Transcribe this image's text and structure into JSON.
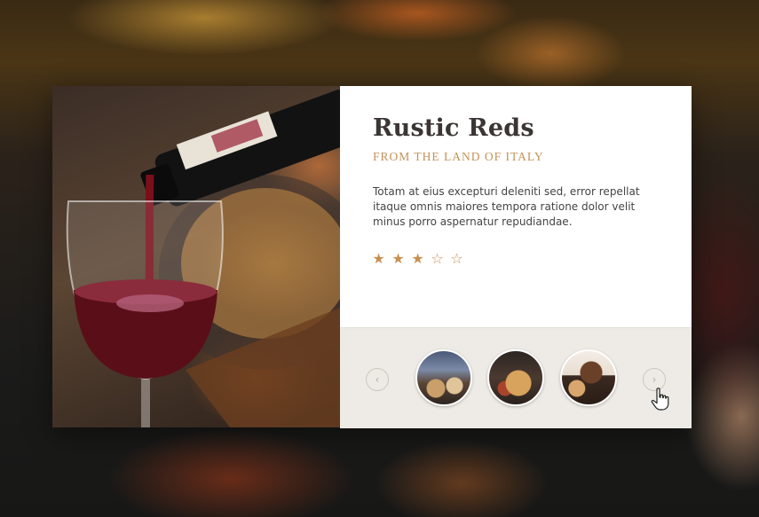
{
  "card": {
    "title": "Rustic Reds",
    "subtitle": "FROM THE LAND OF ITALY",
    "description": "Totam at eius excepturi deleniti sed, error repellat itaque omnis maiores tempora ratione dolor velit minus porro aspernatur repudiandae.",
    "image_icon": "wine-pour-photo"
  },
  "rating": {
    "value": 3,
    "max": 5,
    "filled_glyph": "★",
    "empty_glyph": "☆"
  },
  "carousel": {
    "prev_glyph": "‹",
    "next_glyph": "›",
    "thumbnails": [
      {
        "icon": "food-plates-thumbnail"
      },
      {
        "icon": "pasta-dish-thumbnail"
      },
      {
        "icon": "coffee-cup-thumbnail"
      }
    ]
  },
  "colors": {
    "accent": "#c29358",
    "title": "#3b3533",
    "card_bg": "#ffffff",
    "carousel_bg": "#eeebe6"
  }
}
